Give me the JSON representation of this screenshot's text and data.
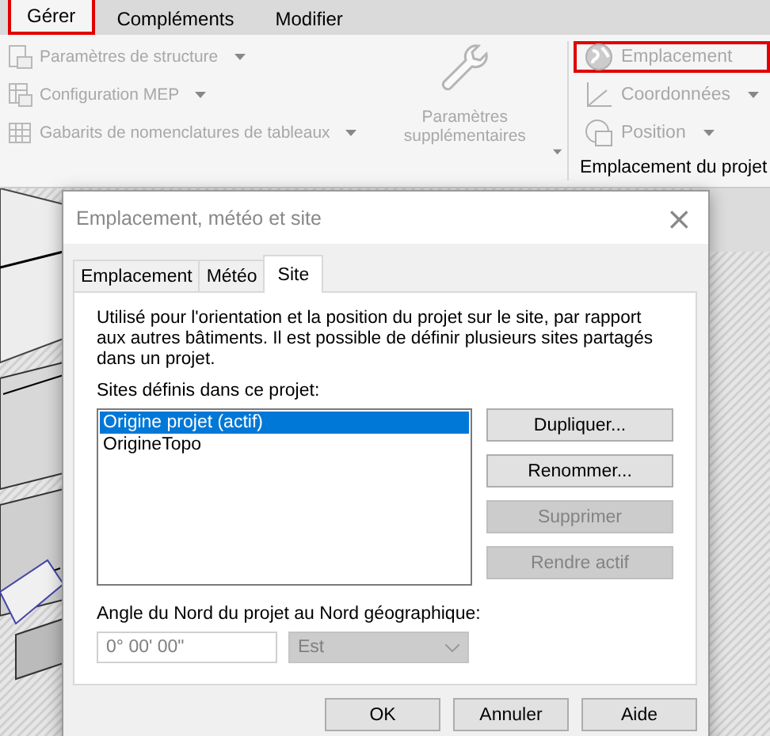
{
  "ribbon_tabs": [
    {
      "label": "Gérer",
      "selected": true,
      "highlighted": true
    },
    {
      "label": "Compléments",
      "selected": false,
      "highlighted": false
    },
    {
      "label": "Modifier",
      "selected": false,
      "highlighted": false
    }
  ],
  "ribbon": {
    "settings_items": [
      {
        "label": "Paramètres de structure",
        "disabled": true
      },
      {
        "label": "Configuration MEP",
        "disabled": true
      },
      {
        "label": "Gabarits de nomenclatures de tableaux",
        "disabled": true
      }
    ],
    "big_button": {
      "label": "Paramètres supplémentaires",
      "disabled": true
    },
    "location_items": [
      {
        "label": "Emplacement",
        "disabled": true,
        "highlighted": true,
        "dropdown": false
      },
      {
        "label": "Coordonnées",
        "disabled": true,
        "highlighted": false,
        "dropdown": true
      },
      {
        "label": "Position",
        "disabled": true,
        "highlighted": false,
        "dropdown": true
      }
    ],
    "panel_label": "Emplacement du projet"
  },
  "dialog": {
    "title": "Emplacement, météo et site",
    "close": "×",
    "tabs": [
      {
        "label": "Emplacement",
        "selected": false
      },
      {
        "label": "Météo",
        "selected": false
      },
      {
        "label": "Site",
        "selected": true
      }
    ],
    "description": "Utilisé pour l'orientation et la position du projet sur le site, par rapport aux autres bâtiments. Il est possible de définir plusieurs sites partagés dans un projet.",
    "sites_label": "Sites définis dans ce projet:",
    "sites": [
      {
        "label": "Origine projet (actif)",
        "selected": true
      },
      {
        "label": "OrigineTopo",
        "selected": false
      }
    ],
    "site_buttons": [
      {
        "label": "Dupliquer...",
        "disabled": false
      },
      {
        "label": "Renommer...",
        "disabled": false
      },
      {
        "label": "Supprimer",
        "disabled": true
      },
      {
        "label": "Rendre actif",
        "disabled": true
      }
    ],
    "angle_label": "Angle du Nord du projet au Nord géographique:",
    "angle": {
      "value": "0° 00' 00\"",
      "disabled": true
    },
    "direction": {
      "value": "Est",
      "disabled": true
    },
    "buttons": [
      "OK",
      "Annuler",
      "Aide"
    ]
  }
}
